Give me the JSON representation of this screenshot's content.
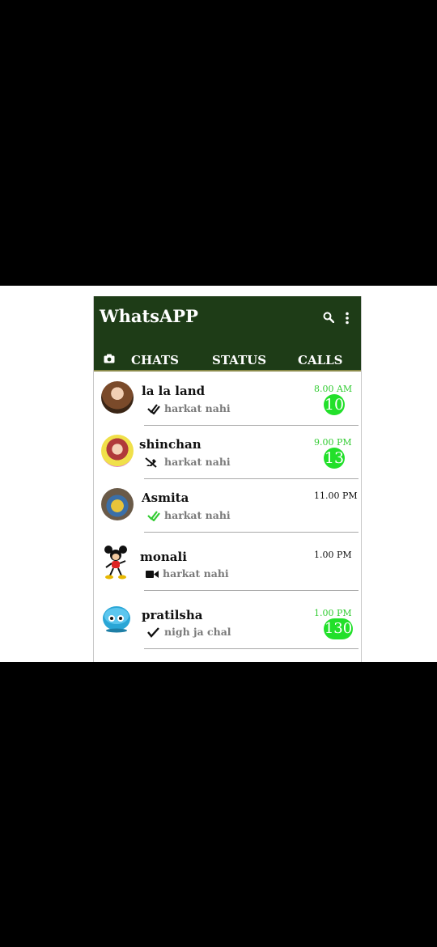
{
  "app": {
    "title": "WhatsAPP",
    "tabs": [
      {
        "label": "CHATS"
      },
      {
        "label": "STATUS"
      },
      {
        "label": "CALLS"
      }
    ],
    "icons": {
      "search": "search-icon",
      "more": "more-vertical-icon",
      "camera": "camera-icon"
    },
    "colors": {
      "header_bg": "#1e3c17",
      "unread_green": "#22e02a",
      "time_green": "#33cc33"
    }
  },
  "chats": [
    {
      "name": "la la land",
      "message": "harkat nahi",
      "status_icon": "double-check-icon",
      "time": "8.00 AM",
      "unread": "10",
      "time_color": "#33cc33"
    },
    {
      "name": "shinchan",
      "message": "harkat nahi",
      "status_icon": "missed-call-icon",
      "time": "9.00 PM",
      "unread": "13",
      "time_color": "#33cc33"
    },
    {
      "name": "Asmita",
      "message": "harkat nahi",
      "status_icon": "double-check-green-icon",
      "time": "11.00 PM",
      "unread": "",
      "time_color": "#111111"
    },
    {
      "name": "monali",
      "message": "harkat nahi",
      "status_icon": "video-call-icon",
      "time": "1.00 PM",
      "unread": "",
      "time_color": "#111111"
    },
    {
      "name": "pratilsha",
      "message": "nigh ja chal",
      "status_icon": "single-check-icon",
      "time": "1.00 PM",
      "unread": "130",
      "time_color": "#33cc33"
    }
  ]
}
